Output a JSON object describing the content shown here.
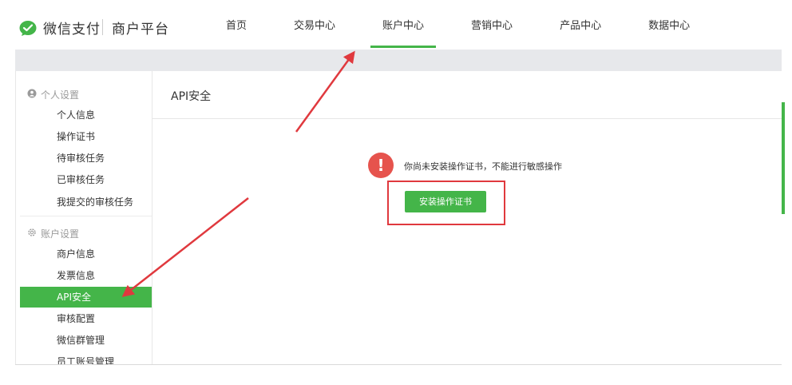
{
  "brand": {
    "name": "微信支付",
    "subtitle": "商户平台"
  },
  "nav": [
    {
      "label": "首页",
      "active": false
    },
    {
      "label": "交易中心",
      "active": false
    },
    {
      "label": "账户中心",
      "active": true
    },
    {
      "label": "营销中心",
      "active": false
    },
    {
      "label": "产品中心",
      "active": false
    },
    {
      "label": "数据中心",
      "active": false
    }
  ],
  "sidebar": {
    "personal": {
      "title": "个人设置",
      "items": [
        "个人信息",
        "操作证书",
        "待审核任务",
        "已审核任务",
        "我提交的审核任务"
      ]
    },
    "account": {
      "title": "账户设置",
      "items": [
        "商户信息",
        "发票信息",
        "API安全",
        "审核配置",
        "微信群管理",
        "员工账号管理"
      ],
      "active_index": 2
    }
  },
  "main": {
    "title": "API安全",
    "warning_text": "你尚未安装操作证书，不能进行敏感操作",
    "warning_icon": "!",
    "install_button": "安装操作证书"
  },
  "colors": {
    "brand_green": "#44b549",
    "warning_red": "#e6534d",
    "annotation_red": "#e0393e"
  }
}
